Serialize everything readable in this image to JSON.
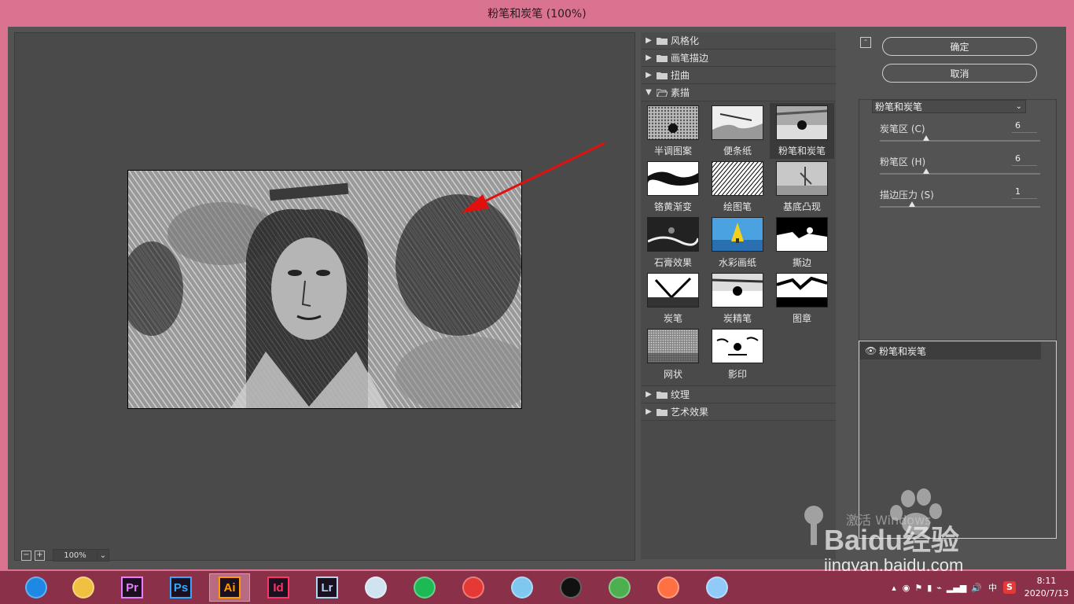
{
  "window": {
    "title": "粉笔和炭笔 (100%)"
  },
  "preview": {
    "zoom": "100%",
    "zoom_out": "−",
    "zoom_in": "+"
  },
  "filters": {
    "categories_top": [
      {
        "label": "风格化",
        "expanded": false
      },
      {
        "label": "画笔描边",
        "expanded": false
      },
      {
        "label": "扭曲",
        "expanded": false
      },
      {
        "label": "素描",
        "expanded": true
      }
    ],
    "sketch_items": [
      {
        "label": "半调图案"
      },
      {
        "label": "便条纸"
      },
      {
        "label": "粉笔和炭笔",
        "selected": true
      },
      {
        "label": "铬黄渐变"
      },
      {
        "label": "绘图笔"
      },
      {
        "label": "基底凸现"
      },
      {
        "label": "石膏效果"
      },
      {
        "label": "水彩画纸"
      },
      {
        "label": "撕边"
      },
      {
        "label": "炭笔"
      },
      {
        "label": "炭精笔"
      },
      {
        "label": "图章"
      },
      {
        "label": "网状"
      },
      {
        "label": "影印"
      }
    ],
    "categories_bottom": [
      {
        "label": "纹理",
        "expanded": false
      },
      {
        "label": "艺术效果",
        "expanded": false
      }
    ]
  },
  "buttons": {
    "ok": "确定",
    "cancel": "取消"
  },
  "settings": {
    "filter_select": "粉笔和炭笔",
    "params": [
      {
        "label": "炭笔区 (C)",
        "value": "6",
        "fraction": 0.29
      },
      {
        "label": "粉笔区 (H)",
        "value": "6",
        "fraction": 0.29
      },
      {
        "label": "描边压力 (S)",
        "value": "1",
        "fraction": 0.2
      }
    ]
  },
  "layers": [
    {
      "label": "粉笔和炭笔"
    }
  ],
  "watermark": {
    "activate": "激活 Windows",
    "brand": "Baidu经验",
    "url": "jingyan.baidu.com"
  },
  "taskbar": {
    "apps": [
      {
        "name": "browser-icon",
        "label": "",
        "color": "#1e88e5"
      },
      {
        "name": "file-explorer-icon",
        "label": "",
        "color": "#f0c040"
      },
      {
        "name": "premiere-icon",
        "label": "Pr",
        "color": "#e77cff"
      },
      {
        "name": "photoshop-icon",
        "label": "Ps",
        "color": "#31a8ff"
      },
      {
        "name": "illustrator-icon",
        "label": "Ai",
        "color": "#ff9a00",
        "active": true
      },
      {
        "name": "indesign-icon",
        "label": "Id",
        "color": "#ff3366"
      },
      {
        "name": "lightroom-icon",
        "label": "Lr",
        "color": "#add5ec"
      },
      {
        "name": "video-editor-icon",
        "label": "",
        "color": "#cfe3f0"
      },
      {
        "name": "green-app-icon",
        "label": "",
        "color": "#1db954"
      },
      {
        "name": "red-app-icon",
        "label": "",
        "color": "#e53935"
      },
      {
        "name": "cat-app-icon",
        "label": "",
        "color": "#7ec8f0"
      },
      {
        "name": "qq-icon",
        "label": "",
        "color": "#111111"
      },
      {
        "name": "chrome-icon",
        "label": "",
        "color": "#4caf50"
      },
      {
        "name": "firefox-icon",
        "label": "",
        "color": "#ff7043"
      },
      {
        "name": "notes-app-icon",
        "label": "",
        "color": "#90caf9"
      }
    ],
    "tray": {
      "ime": "中",
      "time": "8:11",
      "date": "2020/7/13"
    }
  }
}
